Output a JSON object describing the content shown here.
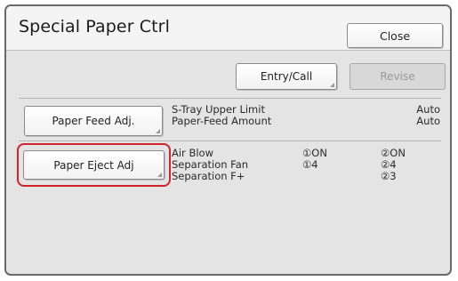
{
  "window": {
    "title": "Special Paper Ctrl",
    "close_label": "Close"
  },
  "toolbar": {
    "entry_call_label": "Entry/Call",
    "revise_label": "Revise"
  },
  "paper_feed": {
    "button_label": "Paper Feed Adj.",
    "items": [
      {
        "label": "S-Tray Upper Limit",
        "value": "Auto"
      },
      {
        "label": "Paper-Feed Amount",
        "value": "Auto"
      }
    ]
  },
  "paper_eject": {
    "button_label": "Paper Eject Adj",
    "highlight_color": "#d2232a",
    "items": [
      {
        "label": "Air Blow",
        "v1": "①ON",
        "v2": "②ON"
      },
      {
        "label": "Separation Fan",
        "v1": "①4",
        "v2": "②4"
      },
      {
        "label": "Separation F+",
        "v1": "",
        "v2": "②3"
      }
    ]
  }
}
